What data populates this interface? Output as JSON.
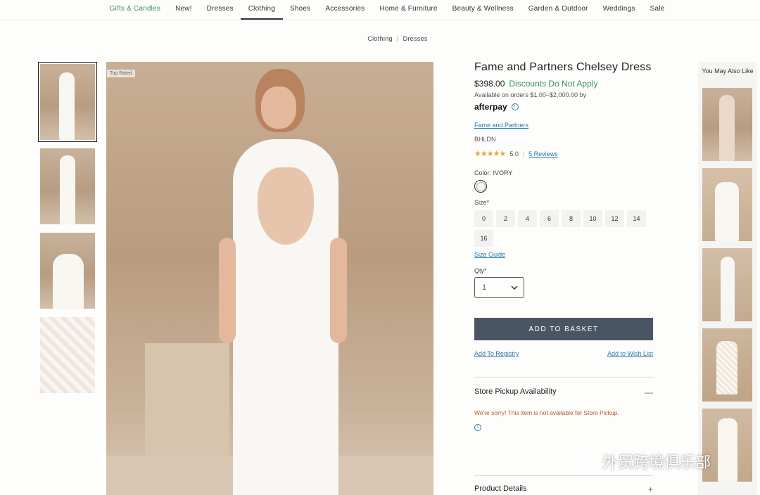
{
  "nav": {
    "items": [
      "Gifts & Candles",
      "New!",
      "Dresses",
      "Clothing",
      "Shoes",
      "Accessories",
      "Home & Furniture",
      "Beauty & Wellness",
      "Garden & Outdoor",
      "Weddings",
      "Sale"
    ]
  },
  "breadcrumb": {
    "first": "Clothing",
    "sep": "/",
    "second": "Dresses"
  },
  "badge": "Top Rated",
  "product": {
    "title": "Fame and Partners Chelsey Dress",
    "price": "$398.00",
    "discount": "Discounts Do Not Apply",
    "availability": "Available on orders $1.00–$2,000.00 by",
    "afterpay": "afterpay",
    "info_glyph": "i",
    "brand_link": "Fame and Partners",
    "brand_code": "BHLDN",
    "stars": "★★★★★",
    "rating": "5.0",
    "rating_sep": "|",
    "reviews": "5 Reviews",
    "color_label": "Color: IVORY",
    "size_label": "Size*",
    "sizes": [
      "0",
      "2",
      "4",
      "6",
      "8",
      "10",
      "12",
      "14",
      "16"
    ],
    "size_guide": "Size Guide",
    "qty_label": "Qty*",
    "qty_value": "1",
    "add_button": "ADD TO BASKET",
    "add_registry": "Add To Registry",
    "add_wishlist": "Add to Wish List",
    "store_pickup": "Store Pickup Availability",
    "store_pickup_toggle": "—",
    "sorry": "We're sorry! This item is not available for Store Pickup.",
    "product_details": "Product Details",
    "product_details_toggle": "+"
  },
  "sidebar": {
    "title": "You May Also Like"
  },
  "watermark": "外贸跨境俱乐部",
  "colors": {
    "accent_green": "#3d8f6a",
    "link_blue": "#2a7aa8",
    "button": "#4a5563",
    "star": "#e0a82e"
  }
}
